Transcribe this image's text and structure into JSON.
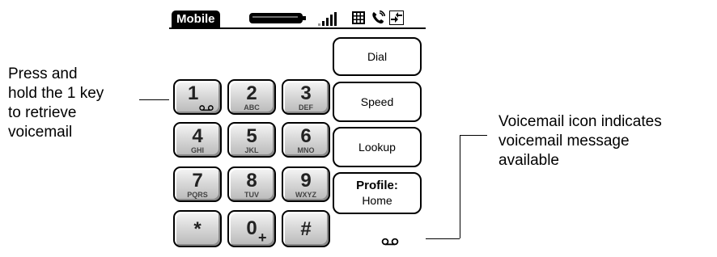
{
  "callouts": {
    "left": "Press and\nhold the 1 key\nto retrieve\nvoicemail",
    "right": "Voicemail icon indicates\nvoicemail message\navailable"
  },
  "titlebar": {
    "title": "Mobile",
    "icons": [
      "battery-icon",
      "signal-strength-icon",
      "keypad-icon",
      "phone-icon",
      "connection-icon"
    ]
  },
  "keypad": {
    "keys": [
      {
        "digit": "1",
        "letters": "",
        "icon": "voicemail-icon"
      },
      {
        "digit": "2",
        "letters": "ABC"
      },
      {
        "digit": "3",
        "letters": "DEF"
      },
      {
        "digit": "4",
        "letters": "GHI"
      },
      {
        "digit": "5",
        "letters": "JKL"
      },
      {
        "digit": "6",
        "letters": "MNO"
      },
      {
        "digit": "7",
        "letters": "PQRS"
      },
      {
        "digit": "8",
        "letters": "TUV"
      },
      {
        "digit": "9",
        "letters": "WXYZ"
      },
      {
        "digit": "*",
        "letters": ""
      },
      {
        "digit": "0",
        "letters": "+"
      },
      {
        "digit": "#",
        "letters": ""
      }
    ]
  },
  "commands": {
    "dial": "Dial",
    "speed": "Speed",
    "lookup": "Lookup",
    "profile_label": "Profile:",
    "profile_value": "Home"
  },
  "status": {
    "voicemail_indicator": "voicemail-icon"
  }
}
